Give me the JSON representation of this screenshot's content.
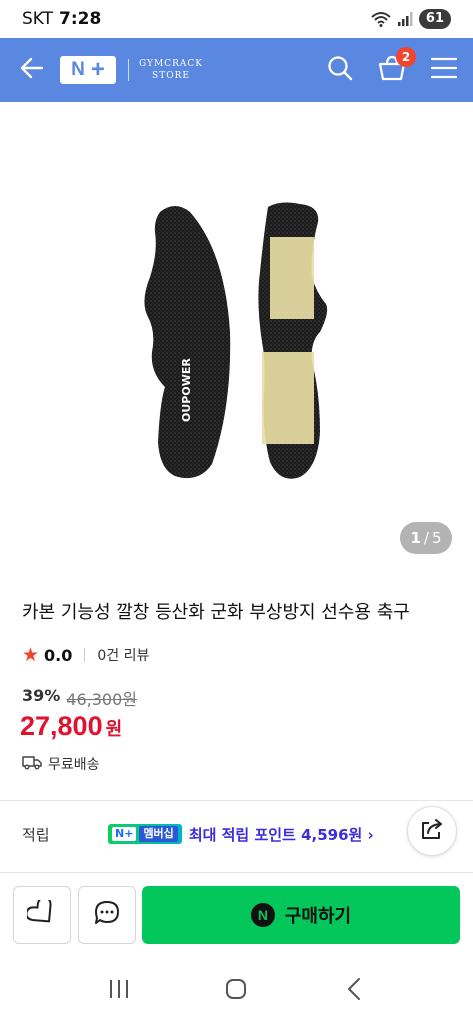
{
  "status_bar": {
    "carrier": "SKT",
    "time": "7:28",
    "battery": "61",
    "icons": [
      "wifi-icon",
      "signal-icon",
      "battery-icon"
    ]
  },
  "header": {
    "logo_text": "N",
    "store_line1": "GYMCRACK",
    "store_line2": "STORE",
    "cart_count": "2",
    "icons": [
      "back-arrow-icon",
      "search-icon",
      "cart-icon",
      "menu-icon"
    ],
    "accent_color": "#5a87e0"
  },
  "gallery": {
    "current_page": "1",
    "total_pages": "5",
    "separator": "/",
    "image_brand_text": "OUPOWER"
  },
  "product": {
    "title": "카본 기능성 깔창 등산화 군화 부상방지 선수용 축구",
    "rating": "0.0",
    "review_count": "0건 리뷰",
    "discount": "39%",
    "original_price": "46,300원",
    "price": "27,800",
    "currency": "원",
    "shipping": "무료배송",
    "price_color": "#e0122d"
  },
  "points": {
    "label": "적립",
    "badge_np": "N+",
    "badge_member": "멤버십",
    "text": "최대 적립 포인트 4,596원 ›"
  },
  "actions": {
    "buy_label": "구매하기",
    "buy_logo": "N",
    "buy_color": "#03c75a",
    "icons": [
      "heart-like-icon",
      "chat-icon",
      "share-icon"
    ]
  },
  "system_nav": {
    "icons": [
      "recent-apps-icon",
      "home-icon",
      "back-icon"
    ]
  }
}
